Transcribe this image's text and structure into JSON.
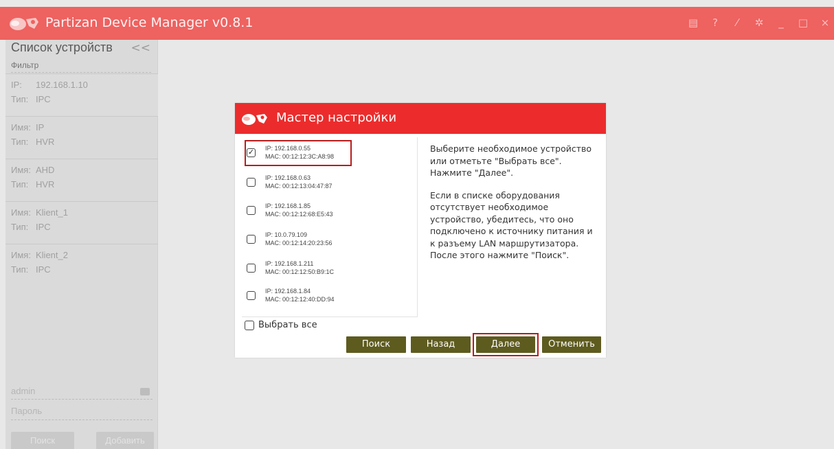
{
  "window": {
    "title": "Partizan Device Manager v0.8.1",
    "icons": [
      "manual-icon",
      "help-icon",
      "wand-icon",
      "settings-icon",
      "minimize-icon",
      "maximize-icon",
      "close-icon"
    ]
  },
  "sidebar": {
    "title": "Список устройств",
    "collapse": "<<",
    "filter_placeholder": "Фильтр",
    "devices": [
      {
        "k1": "IP:",
        "v1": "192.168.1.10",
        "k2": "Тип:",
        "v2": "IPC"
      },
      {
        "k1": "Имя:",
        "v1": "IP",
        "k2": "Тип:",
        "v2": "HVR"
      },
      {
        "k1": "Имя:",
        "v1": "AHD",
        "k2": "Тип:",
        "v2": "HVR"
      },
      {
        "k1": "Имя:",
        "v1": "Klient_1",
        "k2": "Тип:",
        "v2": "IPC"
      },
      {
        "k1": "Имя:",
        "v1": "Klient_2",
        "k2": "Тип:",
        "v2": "IPC"
      }
    ],
    "username": "admin",
    "password_placeholder": "Пароль",
    "search_btn": "Поиск",
    "add_btn": "Добавить"
  },
  "dialog": {
    "title": "Мастер настройки",
    "devices": [
      {
        "ip": "IP: 192.168.0.55",
        "mac": "MAC: 00:12:12:3C:A8:98",
        "checked": true
      },
      {
        "ip": "IP: 192.168.0.63",
        "mac": "MAC: 00:12:13:04:47:87",
        "checked": false
      },
      {
        "ip": "IP: 192.168.1.85",
        "mac": "MAC: 00:12:12:68:E5:43",
        "checked": false
      },
      {
        "ip": "IP: 10.0.79.109",
        "mac": "MAC: 00:12:14:20:23:56",
        "checked": false
      },
      {
        "ip": "IP: 192.168.1.211",
        "mac": "MAC: 00:12:12:50:B9:1C",
        "checked": false
      },
      {
        "ip": "IP: 192.168.1.84",
        "mac": "MAC: 00:12:12:40:DD:94",
        "checked": false
      }
    ],
    "info1": "Выберите необходимое устройство или отметьте \"Выбрать все\". Нажмите \"Далее\".",
    "info2": "Если в списке оборудования отсутствует необходимое устройство, убедитесь, что оно подключено к источнику питания и к разъему LAN маршрутизатора. После этого нажмите \"Поиск\".",
    "select_all": "Выбрать все",
    "buttons": {
      "search": "Поиск",
      "back": "Назад",
      "next": "Далее",
      "cancel": "Отменить"
    }
  },
  "colors": {
    "titlebar": "#ee6260",
    "dialog_header": "#ec2c2c",
    "button": "#5e5b1f",
    "highlight": "#b71c1c"
  }
}
